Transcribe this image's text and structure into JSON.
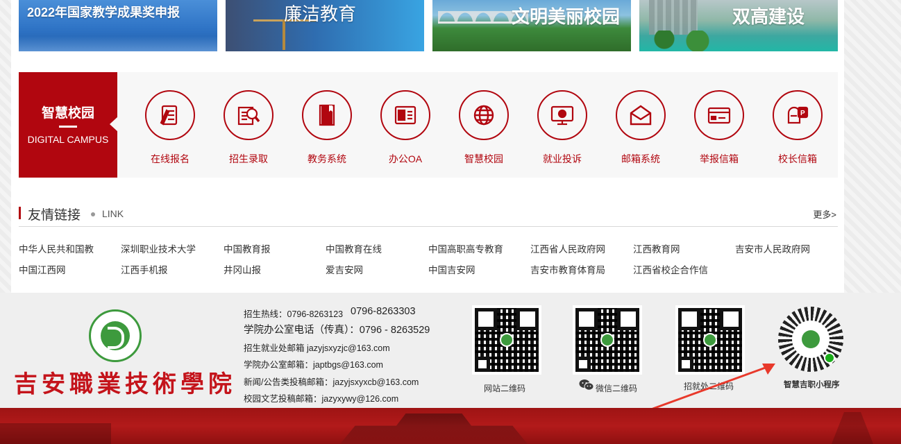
{
  "banners": [
    {
      "text": "2022年国家教学成果奖申报"
    },
    {
      "text": "廉洁教育"
    },
    {
      "text": "文明美丽校园"
    },
    {
      "text": "双高建设"
    }
  ],
  "digital_campus": {
    "title_cn": "智慧校园",
    "title_en": "DIGITAL CAMPUS",
    "items": [
      {
        "label": "在线报名",
        "icon": "form-pen-icon"
      },
      {
        "label": "招生录取",
        "icon": "document-search-icon"
      },
      {
        "label": "教务系统",
        "icon": "book-icon"
      },
      {
        "label": "办公OA",
        "icon": "id-card-icon"
      },
      {
        "label": "智慧校园",
        "icon": "globe-icon"
      },
      {
        "label": "就业投诉",
        "icon": "monitor-icon"
      },
      {
        "label": "邮箱系统",
        "icon": "envelope-icon"
      },
      {
        "label": "举报信箱",
        "icon": "wallet-card-icon"
      },
      {
        "label": "校长信箱",
        "icon": "mailbox-icon"
      }
    ]
  },
  "links": {
    "title": "友情链接",
    "title_en": "LINK",
    "more": "更多>",
    "items": [
      "中华人民共和国教",
      "深圳职业技术大学",
      "中国教育报",
      "中国教育在线",
      "中国高职高专教育",
      "江西省人民政府网",
      "江西教育网",
      "吉安市人民政府网",
      "中国江西网",
      "江西手机报",
      "井冈山报",
      "爱吉安网",
      "中国吉安网",
      "吉安市教育体育局",
      "江西省校企合作信"
    ]
  },
  "footer": {
    "school_name": "吉安職業技術學院",
    "contacts": [
      "招生热线：0796-8263123",
      "0796-8263303",
      "学院办公室电话（传真）：0796 - 8263529",
      "招生就业处邮箱 jazyjsxyzjc@163.com",
      "学院办公室邮箱：japtbgs@163.com",
      "新闻/公告类投稿邮箱：jazyjsxyxcb@163.com",
      "校园文艺投稿邮箱：jazyxywy@126.com"
    ],
    "qr_labels": [
      "网站二维码",
      "微信二维码",
      "招就处二维码",
      "智慧吉职小程序"
    ]
  },
  "colors": {
    "accent": "#b1060f",
    "footer_bg": "#efefef",
    "school_red": "#c4141b",
    "green": "#3d9a3d"
  }
}
